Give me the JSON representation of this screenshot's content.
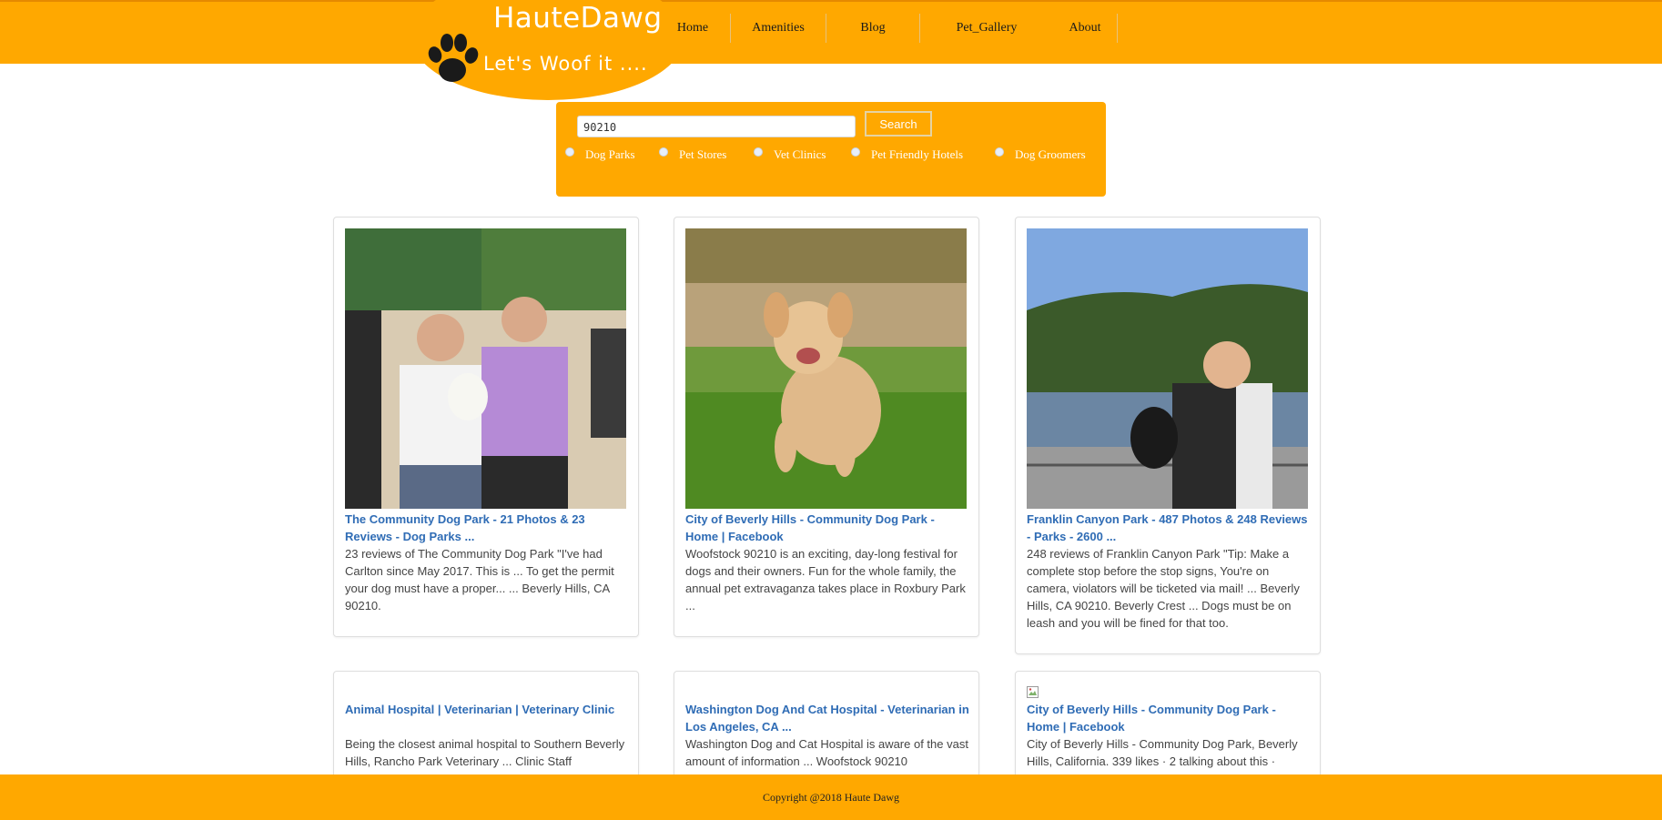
{
  "brand": {
    "title": "HauteDawg",
    "tagline": "Let's Woof it ...."
  },
  "nav": {
    "items": [
      {
        "label": "Home"
      },
      {
        "label": "Amenities"
      },
      {
        "label": "Blog"
      },
      {
        "label": "Pet_Gallery"
      },
      {
        "label": "About"
      }
    ]
  },
  "search": {
    "value": "90210",
    "button_label": "Search",
    "options": [
      {
        "label": "Dog Parks"
      },
      {
        "label": "Pet Stores"
      },
      {
        "label": "Vet Clinics"
      },
      {
        "label": "Pet Friendly Hotels"
      },
      {
        "label": "Dog Groomers"
      }
    ]
  },
  "results": [
    {
      "title": "The Community Dog Park - 21 Photos & 23 Reviews - Dog Parks ...",
      "description": "23 reviews of The Community Dog Park \"I've had Carlton since May 2017. This is ... To get the permit your dog must have a proper... ... Beverly Hills, CA 90210."
    },
    {
      "title": "City of Beverly Hills - Community Dog Park - Home | Facebook",
      "description": "Woofstock 90210 is an exciting, day-long festival for dogs and their owners. Fun for the whole family, the annual pet extravaganza takes place in Roxbury Park ..."
    },
    {
      "title": "Franklin Canyon Park - 487 Photos & 248 Reviews - Parks - 2600 ...",
      "description": "248 reviews of Franklin Canyon Park \"Tip: Make a complete stop before the stop signs, You're on camera, violators will be ticketed via mail! ... Beverly Hills, CA 90210. Beverly Crest ... Dogs must be on leash and you will be fined for that too."
    },
    {
      "title": "Animal Hospital | Veterinarian | Veterinary Clinic",
      "description": "Being the closest animal hospital to Southern Beverly Hills, Rancho Park Veterinary ... Clinic Staff"
    },
    {
      "title": "Washington Dog And Cat Hospital - Veterinarian in Los Angeles, CA ...",
      "description": "Washington Dog and Cat Hospital is aware of the vast amount of information ... Woofstock 90210"
    },
    {
      "title": "City of Beverly Hills - Community Dog Park - Home | Facebook",
      "description": "City of Beverly Hills - Community Dog Park, Beverly Hills, California. 339 likes · 2 talking about this ·"
    }
  ],
  "footer": {
    "copyright": "Copyright @2018 Haute Dawg"
  },
  "colors": {
    "accent": "#ffa800",
    "link": "#2f6cb5"
  }
}
